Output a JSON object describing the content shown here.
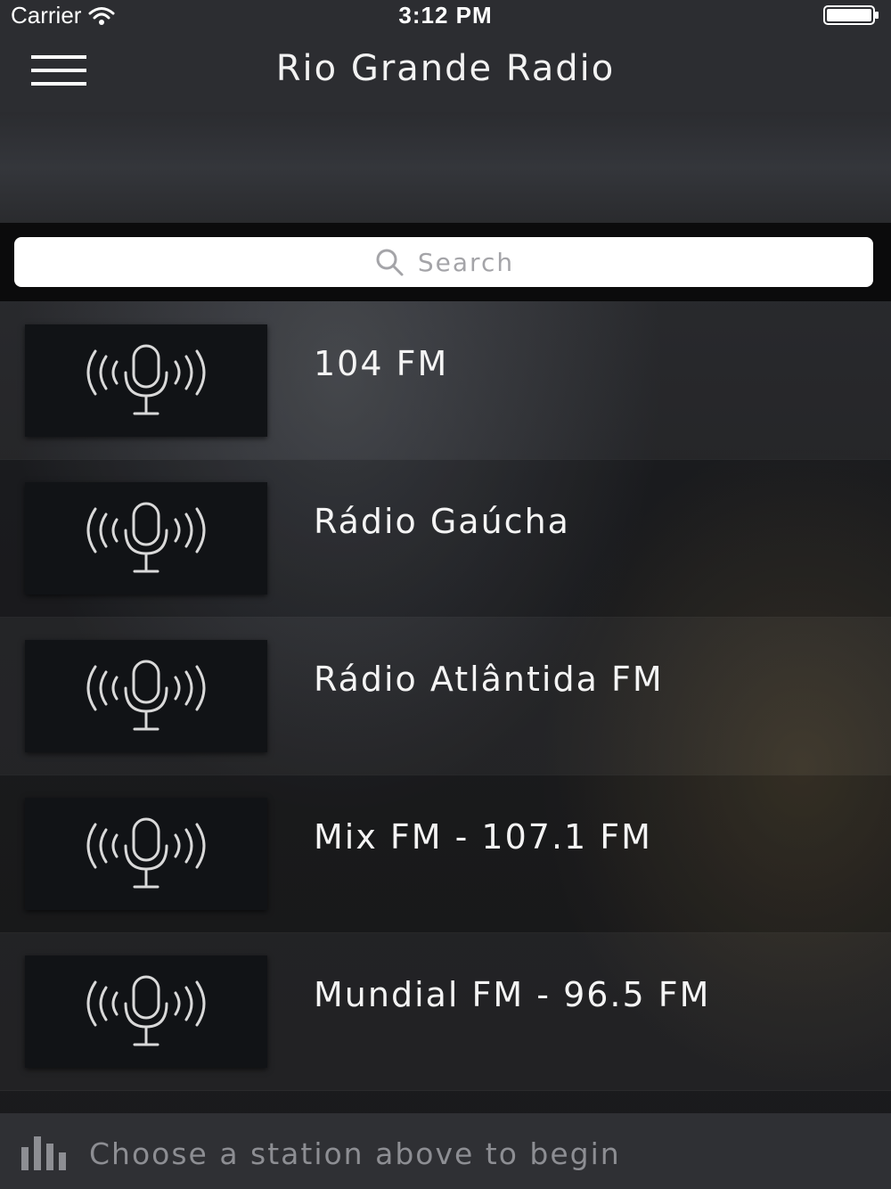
{
  "status_bar": {
    "carrier": "Carrier",
    "time": "3:12 PM"
  },
  "nav": {
    "title": "Rio Grande Radio",
    "menu_icon": "hamburger-menu-icon"
  },
  "search": {
    "placeholder": "Search",
    "icon": "search-icon"
  },
  "stations": [
    {
      "name": "104 FM",
      "icon": "microphone-broadcast-icon"
    },
    {
      "name": "Rádio Gaúcha",
      "icon": "microphone-broadcast-icon"
    },
    {
      "name": "Rádio Atlântida FM",
      "icon": "microphone-broadcast-icon"
    },
    {
      "name": "Mix FM - 107.1 FM",
      "icon": "microphone-broadcast-icon"
    },
    {
      "name": "Mundial FM - 96.5 FM",
      "icon": "microphone-broadcast-icon"
    }
  ],
  "player": {
    "status_text": "Choose a station above to begin",
    "icon": "equalizer-icon"
  },
  "colors": {
    "bar_background": "#2c2d31",
    "search_background": "#ffffff",
    "thumb_background": "#111316",
    "player_text": "#8d8e93"
  }
}
